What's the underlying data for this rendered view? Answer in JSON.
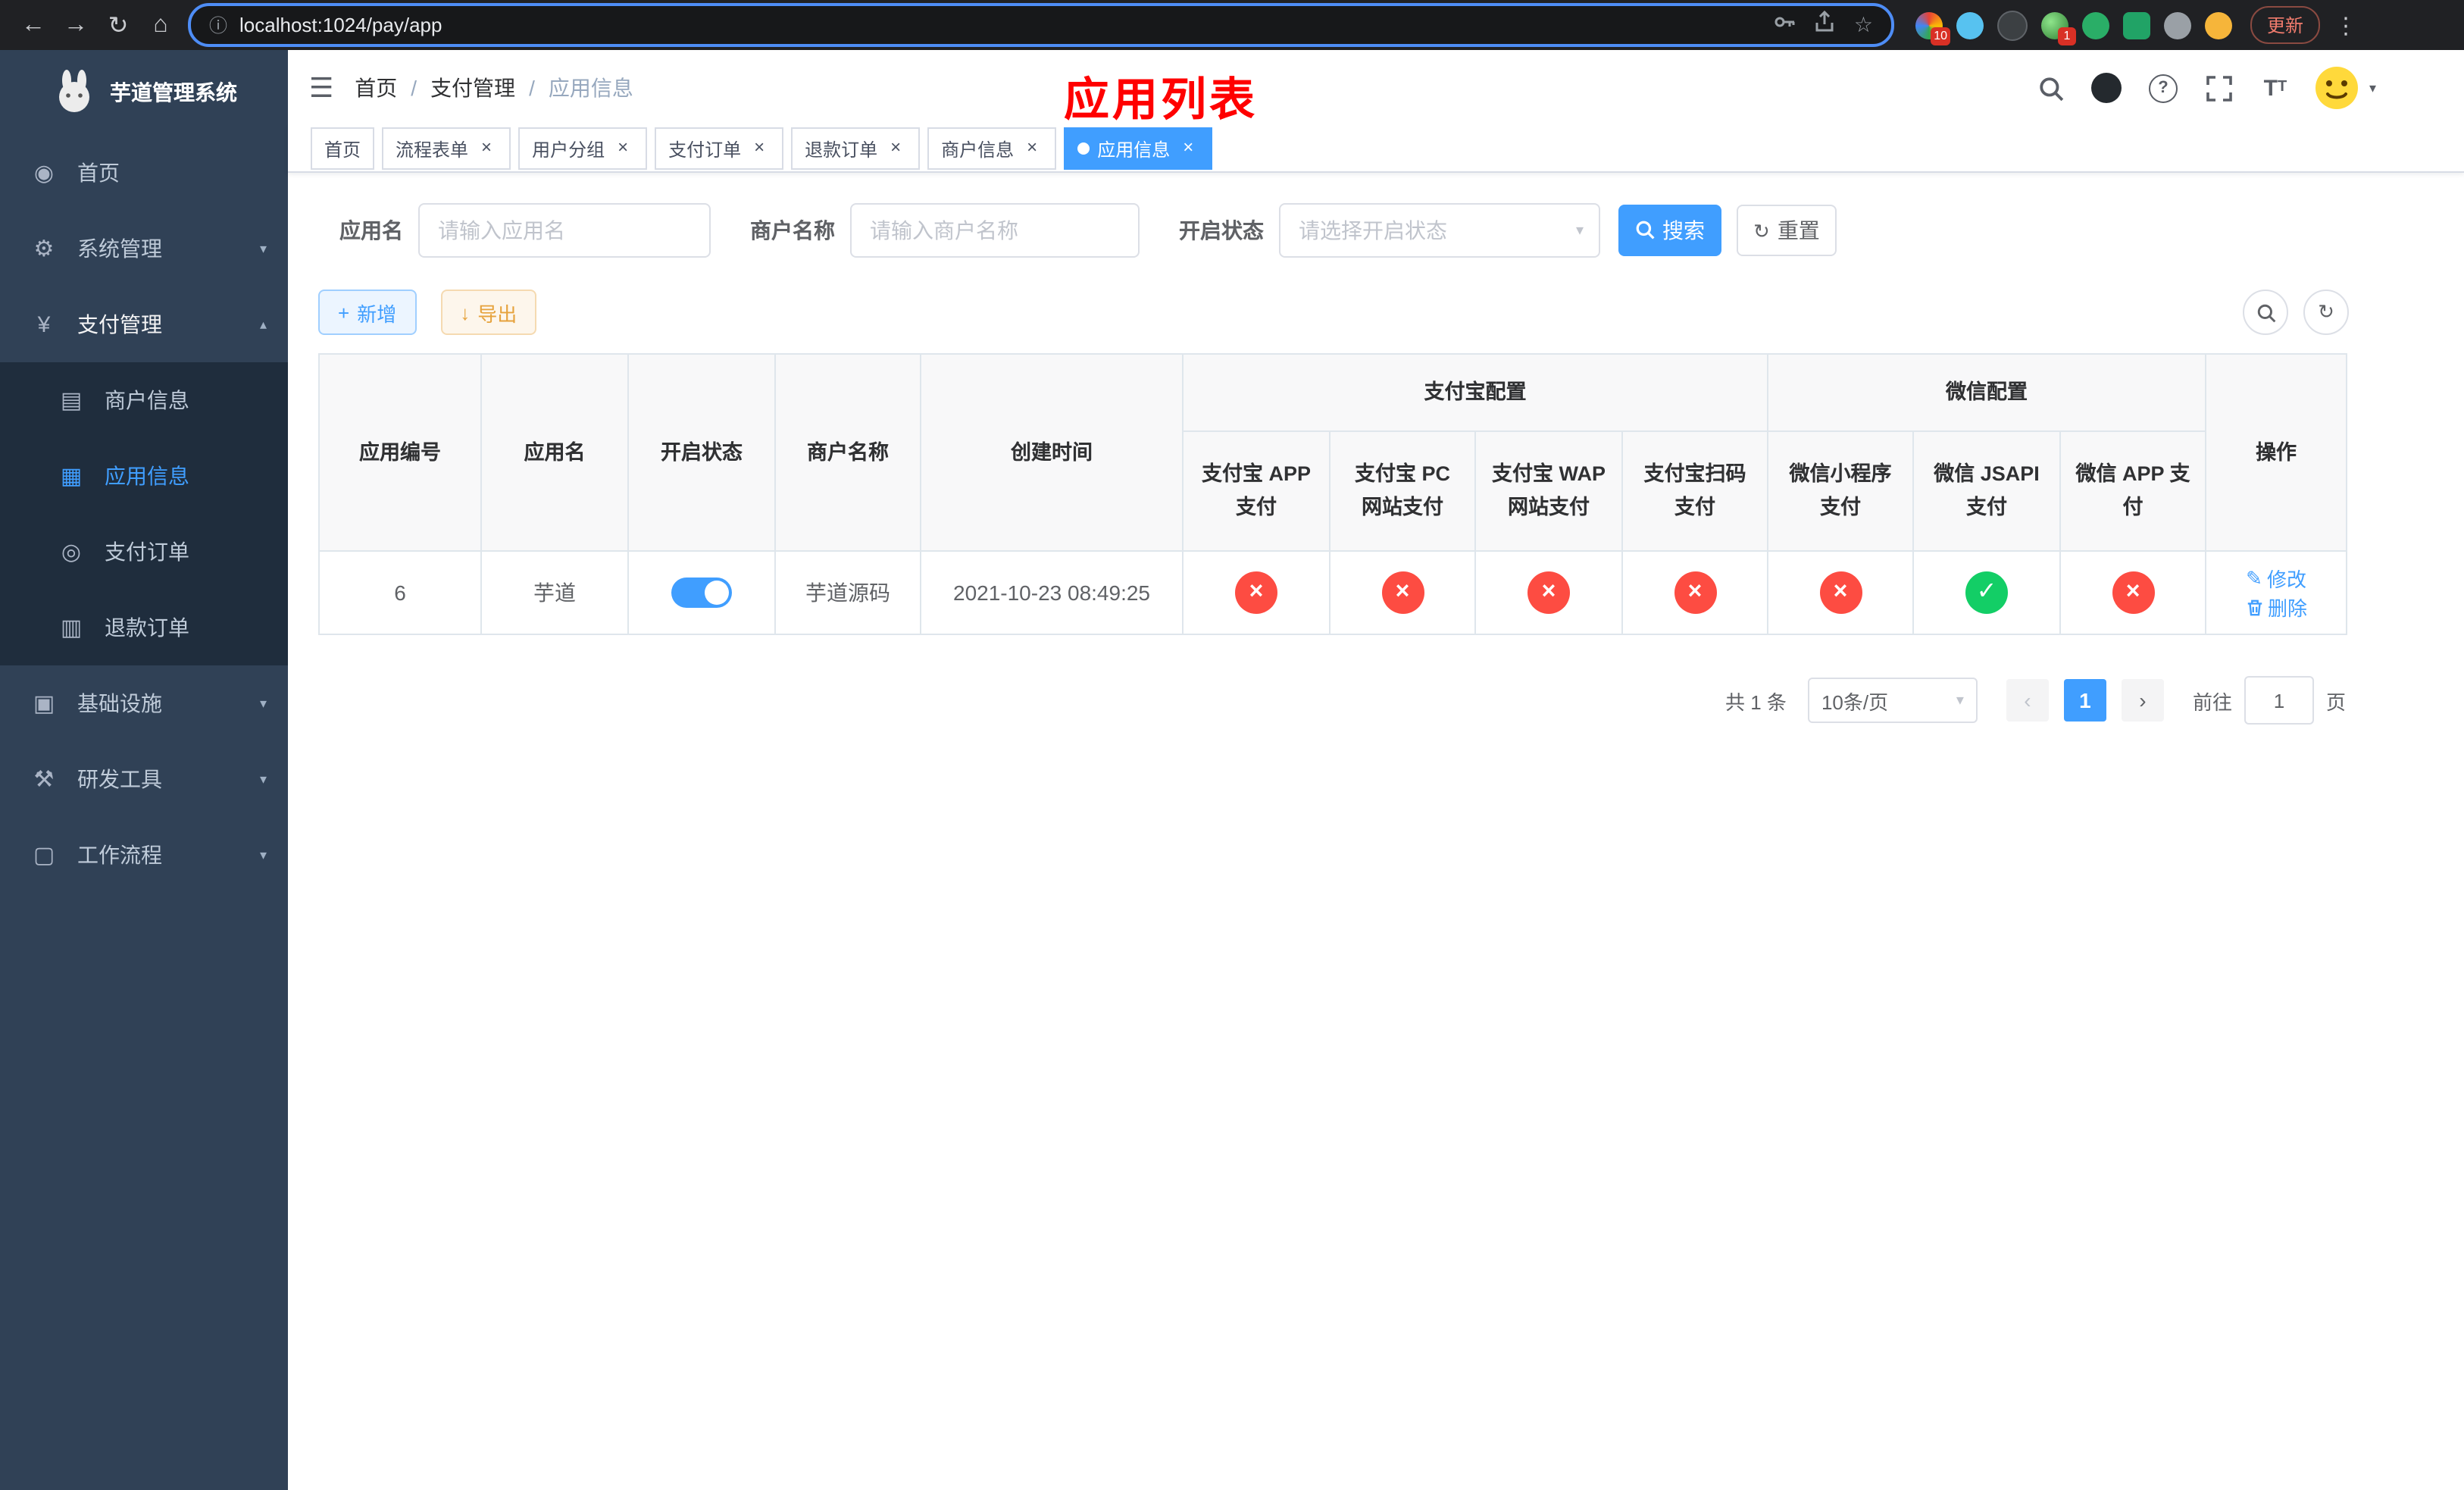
{
  "icons": {
    "back": "←",
    "forward": "→",
    "reload": "↻",
    "home": "⌂",
    "info": "ⓘ",
    "star": "☆",
    "kebab": "⋮",
    "hamburger": "☰",
    "slash": "/",
    "question": "?",
    "caret_down": "▾",
    "caret_up": "▴",
    "dashboard": "◉",
    "gear": "⚙",
    "yen": "¥",
    "merchant": "▤",
    "app_grid": "▦",
    "order": "◎",
    "refund": "▥",
    "infra": "▣",
    "tools": "⚒",
    "workflow": "▢",
    "close": "×",
    "dot": "●",
    "plus": "+",
    "download": "↓",
    "refresh": "↻",
    "edit": "✎",
    "prev": "‹",
    "next": "›",
    "check": "✓",
    "cross": "×",
    "font_large": "T",
    "font_small": "T"
  },
  "browser": {
    "url": "localhost:1024/pay/app",
    "update_label": "更新",
    "badge_1": "10",
    "badge_2": "1"
  },
  "sidebar": {
    "app_title": "芋道管理系统",
    "menu": [
      {
        "label": "首页"
      },
      {
        "label": "系统管理"
      },
      {
        "label": "支付管理"
      },
      {
        "label": "商户信息"
      },
      {
        "label": "应用信息"
      },
      {
        "label": "支付订单"
      },
      {
        "label": "退款订单"
      },
      {
        "label": "基础设施"
      },
      {
        "label": "研发工具"
      },
      {
        "label": "工作流程"
      }
    ]
  },
  "header": {
    "breadcrumb": [
      "首页",
      "支付管理",
      "应用信息"
    ],
    "overlay_title": "应用列表"
  },
  "tags_view": [
    {
      "label": "首页"
    },
    {
      "label": "流程表单"
    },
    {
      "label": "用户分组"
    },
    {
      "label": "支付订单"
    },
    {
      "label": "退款订单"
    },
    {
      "label": "商户信息"
    },
    {
      "label": "应用信息"
    }
  ],
  "filters": {
    "app_name_label": "应用名",
    "app_name_placeholder": "请输入应用名",
    "merchant_label": "商户名称",
    "merchant_placeholder": "请输入商户名称",
    "status_label": "开启状态",
    "status_placeholder": "请选择开启状态",
    "search_label": "搜索",
    "reset_label": "重置"
  },
  "toolbar": {
    "add_label": "新增",
    "export_label": "导出"
  },
  "table": {
    "headers": {
      "app_id": "应用编号",
      "app_name": "应用名",
      "status": "开启状态",
      "merchant": "商户名称",
      "created": "创建时间",
      "alipay_group": "支付宝配置",
      "wechat_group": "微信配置",
      "actions": "操作",
      "channels": [
        "支付宝 APP 支付",
        "支付宝 PC 网站支付",
        "支付宝 WAP 网站支付",
        "支付宝扫码支付",
        "微信小程序支付",
        "微信 JSAPI 支付",
        "微信 APP 支付"
      ]
    },
    "rows": [
      {
        "app_id": "6",
        "app_name": "芋道",
        "enabled": true,
        "merchant": "芋道源码",
        "created": "2021-10-23 08:49:25",
        "channels": [
          "disabled",
          "disabled",
          "disabled",
          "disabled",
          "disabled",
          "enabled",
          "disabled"
        ],
        "edit_label": "修改",
        "delete_label": "删除"
      }
    ]
  },
  "pagination": {
    "total": "共 1 条",
    "page_size": "10条/页",
    "page": "1",
    "goto_label": "前往",
    "goto_value": "1",
    "unit_label": "页"
  },
  "colors": {
    "primary": "#409eff",
    "success": "#13ce66",
    "danger": "#fd4c42",
    "annotation_red": "#ff0000",
    "sidebar_bg": "#304156",
    "submenu_bg": "#1f2d3d"
  }
}
